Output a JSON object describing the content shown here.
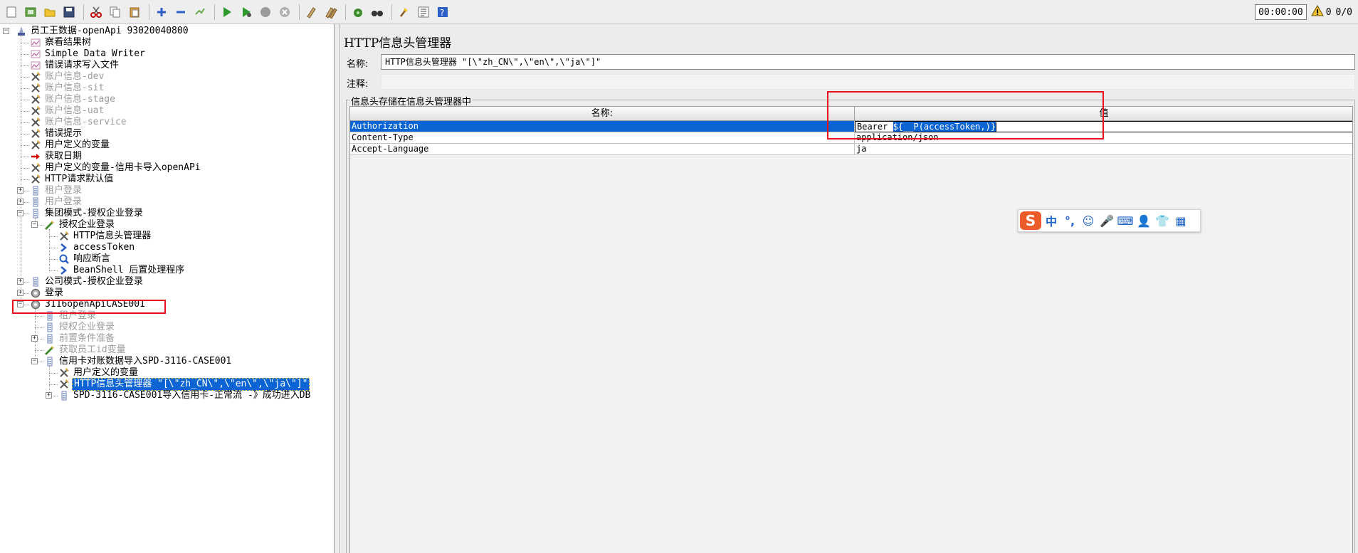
{
  "toolbar": {
    "buttons": [
      {
        "name": "new-icon"
      },
      {
        "name": "templates-icon"
      },
      {
        "name": "open-icon"
      },
      {
        "name": "save-icon"
      },
      {
        "name": "cut-icon"
      },
      {
        "name": "copy-icon"
      },
      {
        "name": "paste-icon"
      },
      {
        "name": "expand-icon"
      },
      {
        "name": "collapse-icon"
      },
      {
        "name": "toggle-icon"
      },
      {
        "name": "start-icon"
      },
      {
        "name": "start-no-pauses-icon"
      },
      {
        "name": "stop-icon"
      },
      {
        "name": "shutdown-icon"
      },
      {
        "name": "clear-icon"
      },
      {
        "name": "clear-all-icon"
      },
      {
        "name": "search-icon"
      },
      {
        "name": "reset-search-icon"
      },
      {
        "name": "function-helper-icon"
      },
      {
        "name": "help-icon"
      },
      {
        "name": "remote-icon"
      }
    ],
    "timer": "00:00:00",
    "warnings": "0",
    "threads": "0/0"
  },
  "tree": {
    "nodes": [
      {
        "label": "员工王数据-openApi  93020040800",
        "depth": 0,
        "exp": "-",
        "icon": "testplan",
        "disabled": false,
        "selected": false
      },
      {
        "label": "察看结果树",
        "depth": 1,
        "exp": "",
        "icon": "listener",
        "disabled": false,
        "selected": false
      },
      {
        "label": "Simple Data Writer",
        "depth": 1,
        "exp": "",
        "icon": "listener",
        "disabled": false,
        "selected": false
      },
      {
        "label": "错误请求写入文件",
        "depth": 1,
        "exp": "",
        "icon": "listener",
        "disabled": false,
        "selected": false
      },
      {
        "label": "账户信息-dev",
        "depth": 1,
        "exp": "",
        "icon": "config",
        "disabled": true,
        "selected": false
      },
      {
        "label": "账户信息-sit",
        "depth": 1,
        "exp": "",
        "icon": "config",
        "disabled": true,
        "selected": false
      },
      {
        "label": "账户信息-stage",
        "depth": 1,
        "exp": "",
        "icon": "config",
        "disabled": true,
        "selected": false
      },
      {
        "label": "账户信息-uat",
        "depth": 1,
        "exp": "",
        "icon": "config",
        "disabled": true,
        "selected": false
      },
      {
        "label": "账户信息-service",
        "depth": 1,
        "exp": "",
        "icon": "config",
        "disabled": true,
        "selected": false
      },
      {
        "label": "错误提示",
        "depth": 1,
        "exp": "",
        "icon": "config",
        "disabled": false,
        "selected": false
      },
      {
        "label": "用户定义的变量",
        "depth": 1,
        "exp": "",
        "icon": "config",
        "disabled": false,
        "selected": false
      },
      {
        "label": "获取日期",
        "depth": 1,
        "exp": "",
        "icon": "pre",
        "disabled": false,
        "selected": false
      },
      {
        "label": "用户定义的变量-信用卡导入openAPi",
        "depth": 1,
        "exp": "",
        "icon": "config",
        "disabled": false,
        "selected": false
      },
      {
        "label": "HTTP请求默认值",
        "depth": 1,
        "exp": "",
        "icon": "config",
        "disabled": false,
        "selected": false
      },
      {
        "label": "租户登录",
        "depth": 1,
        "exp": "+",
        "icon": "controller",
        "disabled": true,
        "selected": false
      },
      {
        "label": "用户登录",
        "depth": 1,
        "exp": "+",
        "icon": "controller",
        "disabled": true,
        "selected": false
      },
      {
        "label": "集团模式-授权企业登录",
        "depth": 1,
        "exp": "-",
        "icon": "controller",
        "disabled": false,
        "selected": false
      },
      {
        "label": "授权企业登录",
        "depth": 2,
        "exp": "-",
        "icon": "sampler",
        "disabled": false,
        "selected": false
      },
      {
        "label": "HTTP信息头管理器",
        "depth": 3,
        "exp": "",
        "icon": "config",
        "disabled": false,
        "selected": false
      },
      {
        "label": "accessToken",
        "depth": 3,
        "exp": "",
        "icon": "post",
        "disabled": false,
        "selected": false
      },
      {
        "label": "响应断言",
        "depth": 3,
        "exp": "",
        "icon": "assert",
        "disabled": false,
        "selected": false
      },
      {
        "label": "BeanShell 后置处理程序",
        "depth": 3,
        "exp": "",
        "icon": "post",
        "disabled": false,
        "selected": false
      },
      {
        "label": "公司模式-授权企业登录",
        "depth": 1,
        "exp": "+",
        "icon": "controller",
        "disabled": false,
        "selected": false
      },
      {
        "label": "登录",
        "depth": 1,
        "exp": "+",
        "icon": "threadgroup",
        "disabled": false,
        "selected": false
      },
      {
        "label": "3116openApiCASE001",
        "depth": 1,
        "exp": "-",
        "icon": "threadgroup",
        "disabled": false,
        "selected": false
      },
      {
        "label": "租户登录",
        "depth": 2,
        "exp": "",
        "icon": "controller",
        "disabled": true,
        "selected": false
      },
      {
        "label": "授权企业登录",
        "depth": 2,
        "exp": "",
        "icon": "controller",
        "disabled": true,
        "selected": false
      },
      {
        "label": "前置条件准备",
        "depth": 2,
        "exp": "+",
        "icon": "controller",
        "disabled": true,
        "selected": false
      },
      {
        "label": "获取员工id变量",
        "depth": 2,
        "exp": "",
        "icon": "sampler",
        "disabled": true,
        "selected": false
      },
      {
        "label": "信用卡对账数据导入SPD-3116-CASE001",
        "depth": 2,
        "exp": "-",
        "icon": "controller",
        "disabled": false,
        "selected": false
      },
      {
        "label": "用户定义的变量",
        "depth": 3,
        "exp": "",
        "icon": "config",
        "disabled": false,
        "selected": false
      },
      {
        "label": "HTTP信息头管理器  \"[\\\"zh_CN\\\",\\\"en\\\",\\\"ja\\\"]\"",
        "depth": 3,
        "exp": "",
        "icon": "config",
        "disabled": false,
        "selected": true
      },
      {
        "label": "SPD-3116-CASE001导入信用卡-正常流 -》成功进入DB",
        "depth": 3,
        "exp": "+",
        "icon": "controller",
        "disabled": false,
        "selected": false
      }
    ]
  },
  "panel": {
    "title": "HTTP信息头管理器",
    "name_label": "名称:",
    "name_value": "HTTP信息头管理器  \"[\\\"zh_CN\\\",\\\"en\\\",\\\"ja\\\"]\"",
    "comment_label": "注释:",
    "comment_value": "",
    "group_title": "信息头存储在信息头管理器中",
    "columns": [
      "名称:",
      "值"
    ],
    "rows": [
      {
        "name": "Authorization",
        "value_prefix": "Bearer ",
        "value_selected": "${__P(accessToken,)}",
        "selected": true
      },
      {
        "name": "Content-Type",
        "value": "application/json",
        "selected": false
      },
      {
        "name": "Accept-Language",
        "value": "ja",
        "selected": false
      }
    ]
  },
  "ime": {
    "logo": "S",
    "items": [
      {
        "name": "chinese-mode-icon",
        "text": "中"
      },
      {
        "name": "punctuation-icon",
        "text": "°,"
      },
      {
        "name": "emoji-icon",
        "text": "☺"
      },
      {
        "name": "microphone-icon",
        "text": "🎤"
      },
      {
        "name": "keyboard-icon",
        "text": "⌨"
      },
      {
        "name": "user-icon",
        "text": "👤"
      },
      {
        "name": "skin-icon",
        "text": "👕"
      },
      {
        "name": "toolbox-icon",
        "text": "▦"
      }
    ]
  },
  "colors": {
    "selection": "#0a64d4",
    "annotation": "#e8101a",
    "ime_brand": "#ee5b2b"
  }
}
